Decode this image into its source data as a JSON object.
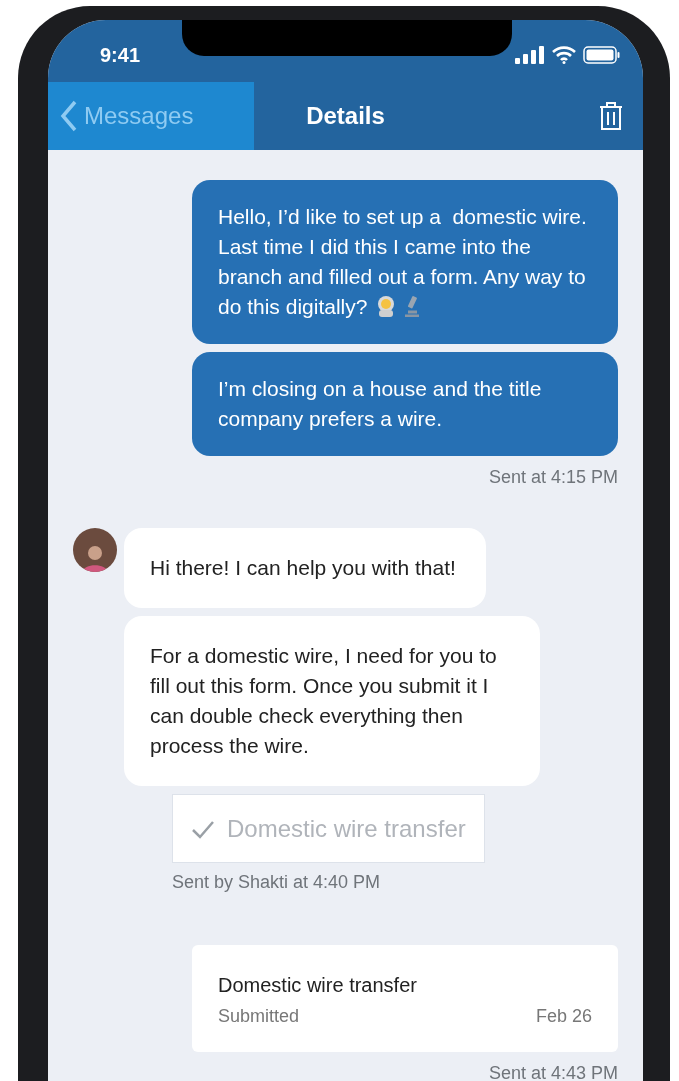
{
  "status_bar": {
    "time": "9:41"
  },
  "nav": {
    "back": {
      "label": "Messages",
      "highlighted": true
    },
    "title": "Details"
  },
  "messages": [
    {
      "kind": "outgoing",
      "text": "Hello, I’d like to set up a  domestic wire. Last time I did this I came into the branch and filled out a form. Any way to do this digitally?",
      "emoji": true
    },
    {
      "kind": "outgoing",
      "text": "I’m closing on a house and the title company prefers a wire.",
      "emoji": false
    },
    {
      "kind": "sent_note",
      "text": "Sent at 4:15 PM"
    },
    {
      "kind": "incoming",
      "avatar": true,
      "text": "Hi there! I can help you with that!"
    },
    {
      "kind": "incoming",
      "avatar": false,
      "text": "For a domestic wire, I need for you to fill out this form. Once you submit it I can double check everything then process the wire."
    },
    {
      "kind": "form_link",
      "completed": true,
      "label": "Domestic wire transfer"
    },
    {
      "kind": "agent_note",
      "text": "Sent by Shakti at 4:40 PM"
    },
    {
      "kind": "form_card",
      "title": "Domestic wire transfer",
      "status": "Submitted",
      "date": "Feb 26"
    },
    {
      "kind": "sent_note",
      "text": "Sent at 4:43 PM"
    }
  ]
}
